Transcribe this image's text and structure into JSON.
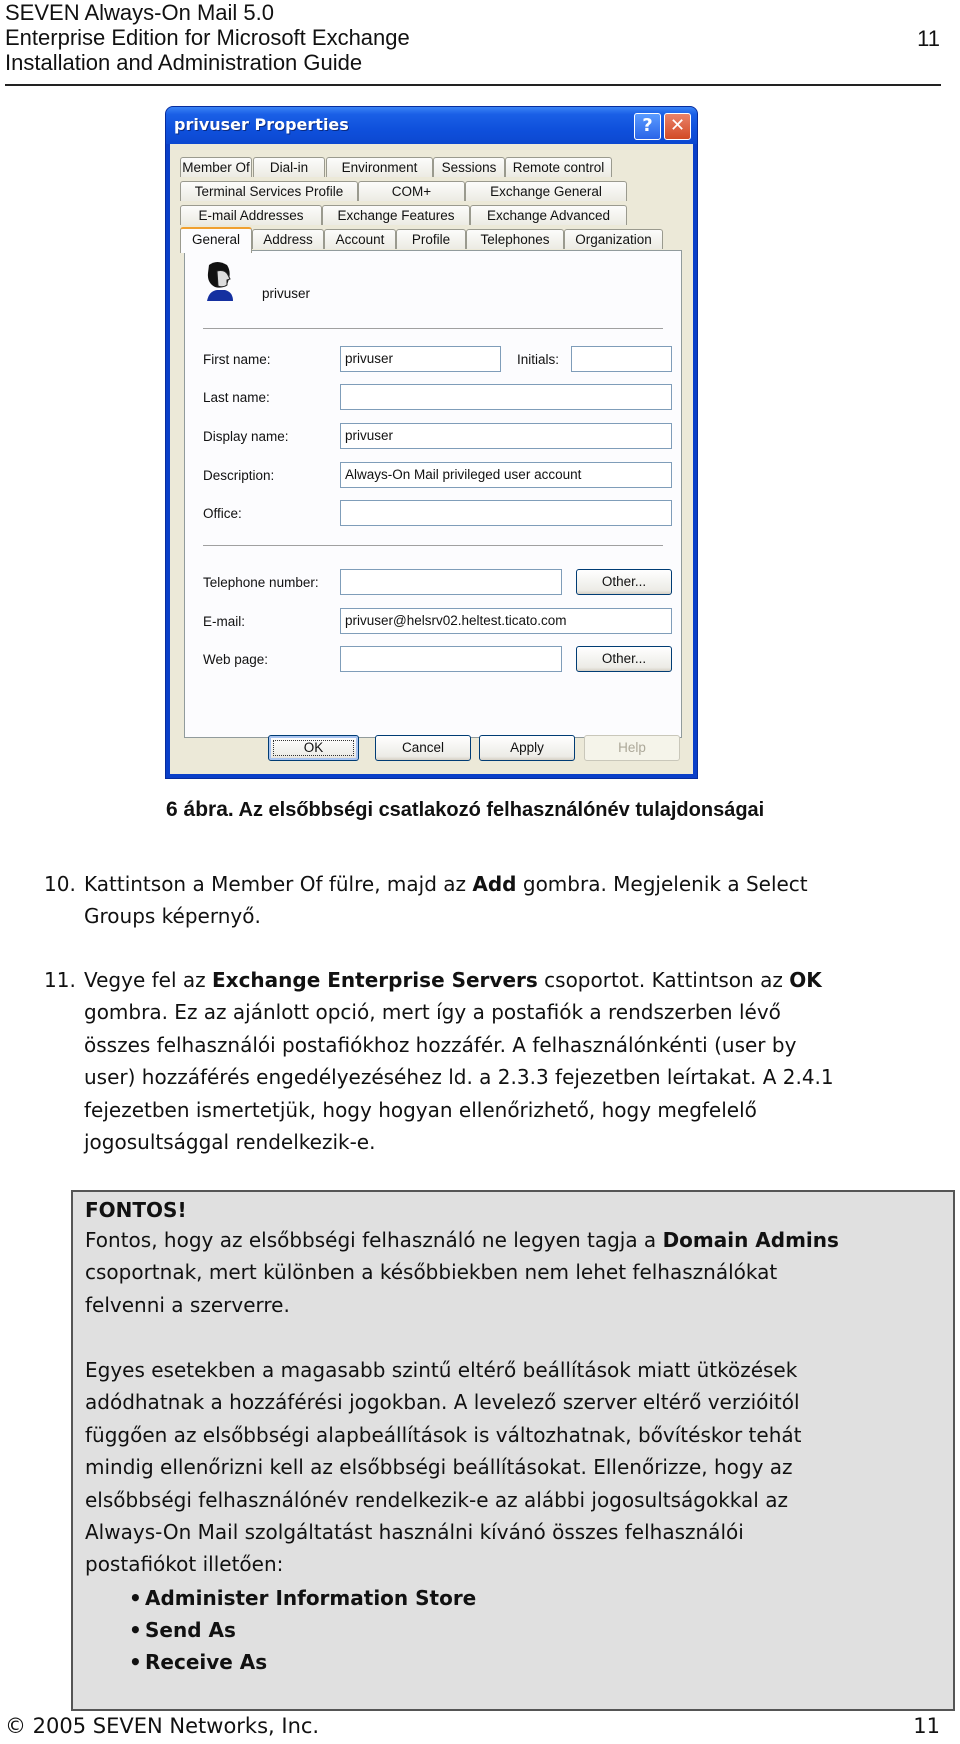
{
  "header": {
    "line1": "SEVEN Always-On Mail 5.0",
    "line2": "Enterprise Edition for Microsoft Exchange",
    "line3": "Installation and Administration Guide",
    "page_number": "11"
  },
  "dialog": {
    "title": "privuser Properties",
    "help_button": "?",
    "close_button": "✕",
    "tabs": [
      {
        "label": "Member Of",
        "row": 1
      },
      {
        "label": "Dial-in",
        "row": 1
      },
      {
        "label": "Environment",
        "row": 1
      },
      {
        "label": "Sessions",
        "row": 1
      },
      {
        "label": "Remote control",
        "row": 1
      },
      {
        "label": "Terminal Services Profile",
        "row": 2
      },
      {
        "label": "COM+",
        "row": 2
      },
      {
        "label": "Exchange General",
        "row": 2
      },
      {
        "label": "E-mail Addresses",
        "row": 3
      },
      {
        "label": "Exchange Features",
        "row": 3
      },
      {
        "label": "Exchange Advanced",
        "row": 3
      },
      {
        "label": "General",
        "row": 4,
        "active": true
      },
      {
        "label": "Address",
        "row": 4
      },
      {
        "label": "Account",
        "row": 4
      },
      {
        "label": "Profile",
        "row": 4
      },
      {
        "label": "Telephones",
        "row": 4
      },
      {
        "label": "Organization",
        "row": 4
      }
    ],
    "user_display": "privuser",
    "fields": {
      "first_name": {
        "label": "First name:",
        "value": "privuser"
      },
      "initials": {
        "label": "Initials:",
        "value": ""
      },
      "last_name": {
        "label": "Last name:",
        "value": ""
      },
      "display_name": {
        "label": "Display name:",
        "value": "privuser"
      },
      "description": {
        "label": "Description:",
        "value": "Always-On Mail privileged user account"
      },
      "office": {
        "label": "Office:",
        "value": ""
      },
      "telephone": {
        "label": "Telephone number:",
        "value": ""
      },
      "email": {
        "label": "E-mail:",
        "value": "privuser@helsrv02.heltest.ticato.com"
      },
      "web_page": {
        "label": "Web page:",
        "value": ""
      }
    },
    "other_button": "Other...",
    "buttons": {
      "ok": "OK",
      "cancel": "Cancel",
      "apply": "Apply",
      "help": "Help"
    }
  },
  "caption": {
    "number": "6 ábra.",
    "text": " Az elsőbbségi csatlakozó felhasználónév tulajdonságai"
  },
  "steps": [
    {
      "number": "10.",
      "lines": [
        [
          "Kattintson a Member Of fülre, majd az ",
          {
            "b": "Add"
          },
          " gombra. Megjelenik a Select"
        ],
        [
          "Groups képernyő."
        ]
      ]
    },
    {
      "number": "11.",
      "lines": [
        [
          "Vegye fel az ",
          {
            "b": "Exchange Enterprise Servers"
          },
          " csoportot. Kattintson az ",
          {
            "b": "OK"
          }
        ],
        [
          "gombra. Ez az ajánlott opció, mert így a postafiók a rendszerben lévő"
        ],
        [
          "összes felhasználói postafiókhoz hozzáfér. A felhasználónkénti (user by"
        ],
        [
          "user) hozzáférés engedélyezéséhez ld. a 2.3.3 fejezetben leírtakat. A 2.4.1"
        ],
        [
          "fejezetben ismertetjük, hogy hogyan ellenőrizhető, hogy megfelelő"
        ],
        [
          "jogosultsággal rendelkezik-e."
        ]
      ]
    }
  ],
  "note": {
    "title": "FONTOS!",
    "para1": [
      [
        "Fontos, hogy az elsőbbségi felhasználó ne legyen tagja a ",
        {
          "b": "Domain Admins"
        }
      ],
      [
        "csoportnak, mert különben a későbbiekben nem lehet felhasználókat"
      ],
      [
        "felvenni a szerverre."
      ]
    ],
    "para2": [
      [
        "Egyes esetekben a magasabb szintű eltérő beállítások miatt ütközések"
      ],
      [
        "adódhatnak a hozzáférési jogokban. A levelező szerver eltérő verzióitól"
      ],
      [
        "függően az elsőbbségi alapbeállítások is változhatnak, bővítéskor tehát"
      ],
      [
        "mindig ellenőrizni kell az elsőbbségi beállításokat. Ellenőrizze, hogy az"
      ],
      [
        "elsőbbségi felhasználónév rendelkezik-e az alábbi jogosultságokkal az"
      ],
      [
        "Always-On Mail szolgáltatást használni kívánó összes felhasználói"
      ],
      [
        "postafiókot illetően:"
      ]
    ],
    "bullets": [
      "Administer Information Store",
      "Send As",
      "Receive As"
    ]
  },
  "footer": {
    "copyright": "© 2005 SEVEN Networks, Inc.",
    "page_number": "11"
  }
}
